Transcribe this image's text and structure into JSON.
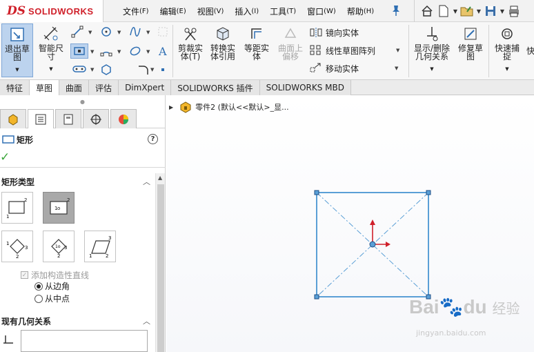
{
  "logo": {
    "mark": "DS",
    "word": "SOLIDWORKS"
  },
  "menu": [
    {
      "label": "文件",
      "key": "(F)"
    },
    {
      "label": "编辑",
      "key": "(E)"
    },
    {
      "label": "视图",
      "key": "(V)"
    },
    {
      "label": "插入",
      "key": "(I)"
    },
    {
      "label": "工具",
      "key": "(T)"
    },
    {
      "label": "窗口",
      "key": "(W)"
    },
    {
      "label": "帮助",
      "key": "(H)"
    }
  ],
  "ribbon": {
    "exit_sketch": [
      "退出草",
      "图"
    ],
    "smart_dim": [
      "智能尺",
      "寸"
    ],
    "trim": [
      "剪裁实",
      "体(T)"
    ],
    "convert": [
      "转换实",
      "体引用"
    ],
    "offset": [
      "等距实",
      "体"
    ],
    "offset_on_surface": [
      "曲面上",
      "偏移"
    ],
    "mirror": "镜向实体",
    "linear_pattern": "线性草图阵列",
    "move": "移动实体",
    "display_relations": [
      "显示/删除",
      "几何关系"
    ],
    "repair": [
      "修复草",
      "图"
    ],
    "quick_snap": [
      "快速捕",
      "捉"
    ],
    "quick_more": "快"
  },
  "tabs": [
    "特征",
    "草图",
    "曲面",
    "评估",
    "DimXpert",
    "SOLIDWORKS 插件",
    "SOLIDWORKS MBD"
  ],
  "active_tab": 1,
  "panel": {
    "title": "矩形",
    "help": "?",
    "group_rect_type": "矩形类型",
    "add_construction": "添加构造性直线",
    "from_corner": "从边角",
    "from_center": "从中点",
    "group_relations": "现有几何关系"
  },
  "tree": {
    "label": "零件2  (默认<<默认>_显..."
  },
  "watermark": {
    "brand": "Bai",
    "brand2": "du",
    "suffix": "经验",
    "url": "jingyan.baidu.com"
  },
  "colors": {
    "accent": "#2f6fb3",
    "sketch_line": "#5a9fd6",
    "selection": "#bcd3ee"
  }
}
